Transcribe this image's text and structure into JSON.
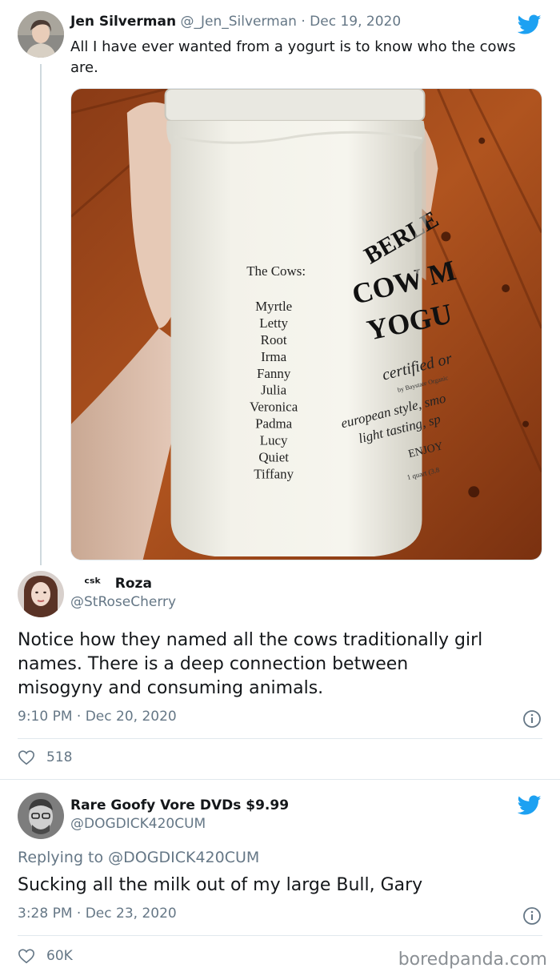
{
  "tweet1": {
    "display_name": "Jen Silverman",
    "handle": "@_Jen_Silverman",
    "separator": "·",
    "date": "Dec 19, 2020",
    "text": "All I have ever wanted from a yogurt is to know who the cows are."
  },
  "photo": {
    "label_title": "The Cows:",
    "cow_names": [
      "Myrtle",
      "Letty",
      "Root",
      "Irma",
      "Fanny",
      "Julia",
      "Veronica",
      "Padma",
      "Lucy",
      "Quiet",
      "Tiffany"
    ],
    "brand_text": "BERLE",
    "product_line1": "COW M",
    "product_line2": "YOGU",
    "certified_text": "certified or",
    "small_text": "by Baystate Organic",
    "desc_line1": "european style, smo",
    "desc_line2": "light tasting, sp",
    "enjoy_text": "ENJOY",
    "quart_text": "1 quart (3.8"
  },
  "tweet2": {
    "display_name": " ᶜˢᵏ Roza",
    "handle": "@StRoseCherry",
    "text_lines": [
      "Notice how they named all the cows traditionally girl",
      "names. There is a deep connection between",
      "misogyny and consuming animals."
    ],
    "time": "9:10 PM",
    "separator": "·",
    "date": "Dec 20, 2020",
    "likes": "518"
  },
  "tweet3": {
    "display_name": "Rare Goofy Vore DVDs $9.99",
    "handle": "@DOGDICK420CUM",
    "replying_prefix": "Replying to",
    "replying_to": "@DOGDICK420CUM",
    "text": "Sucking all the milk out of my large Bull, Gary",
    "time": "3:28 PM",
    "separator": "·",
    "date": "Dec 23, 2020",
    "likes": "60K"
  },
  "watermark": "boredpanda.com",
  "colors": {
    "twitter_blue": "#1da1f2",
    "text_primary": "#14171a",
    "text_secondary": "#657786",
    "divider": "#e1e8ed"
  },
  "icons": {
    "bird": "twitter-bird-icon",
    "info": "info-icon",
    "like": "heart-icon"
  }
}
